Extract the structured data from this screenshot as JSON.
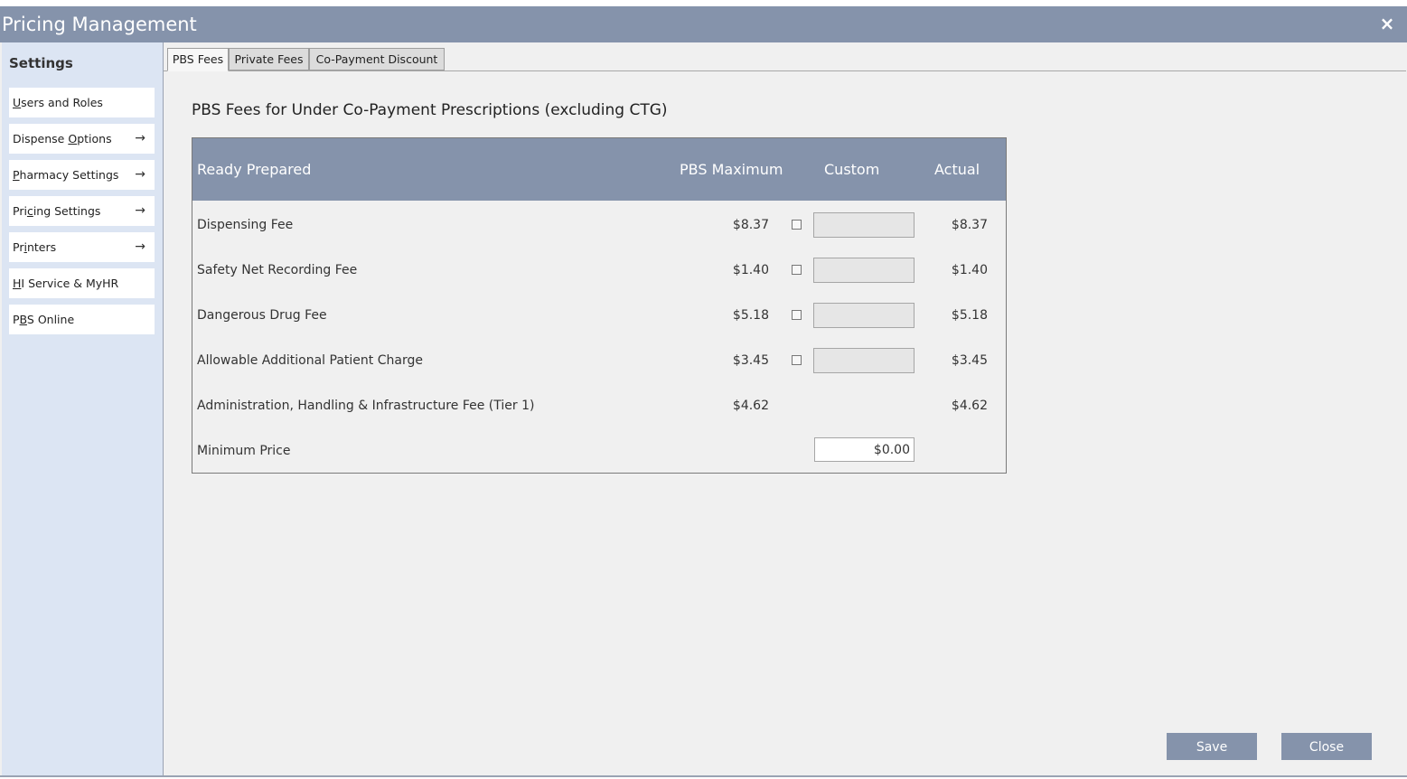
{
  "window": {
    "title": "Pricing Management",
    "close_glyph": "×"
  },
  "sidebar": {
    "heading": "Settings",
    "items": [
      {
        "pre": "",
        "u": "U",
        "post": "sers and Roles",
        "has_arrow": false
      },
      {
        "pre": "Dispense ",
        "u": "O",
        "post": "ptions",
        "has_arrow": true
      },
      {
        "pre": "",
        "u": "P",
        "post": "harmacy Settings",
        "has_arrow": true
      },
      {
        "pre": "Pri",
        "u": "c",
        "post": "ing Settings",
        "has_arrow": true
      },
      {
        "pre": "Pr",
        "u": "i",
        "post": "nters",
        "has_arrow": true
      },
      {
        "pre": "",
        "u": "H",
        "post": "I Service & MyHR",
        "has_arrow": false
      },
      {
        "pre": "P",
        "u": "B",
        "post": "S Online",
        "has_arrow": false
      }
    ],
    "arrow_glyph": "→"
  },
  "tabs": [
    {
      "label": "PBS Fees",
      "active": true
    },
    {
      "label": "Private Fees",
      "active": false
    },
    {
      "label": "Co-Payment Discount",
      "active": false
    }
  ],
  "section_title": "PBS Fees for Under Co-Payment Prescriptions (excluding CTG)",
  "table": {
    "headers": {
      "label": "Ready Prepared",
      "max": "PBS Maximum",
      "custom": "Custom",
      "actual": "Actual"
    },
    "rows": [
      {
        "label": "Dispensing Fee",
        "max": "$8.37",
        "actual": "$8.37",
        "custom_value": ""
      },
      {
        "label": "Safety Net Recording Fee",
        "max": "$1.40",
        "actual": "$1.40",
        "custom_value": ""
      },
      {
        "label": "Dangerous Drug Fee",
        "max": "$5.18",
        "actual": "$5.18",
        "custom_value": ""
      },
      {
        "label": "Allowable Additional Patient Charge",
        "max": "$3.45",
        "actual": "$3.45",
        "custom_value": ""
      },
      {
        "label": "Administration, Handling & Infrastructure Fee (Tier 1)",
        "max": "$4.62",
        "actual": "$4.62"
      },
      {
        "label": "Minimum Price",
        "custom_value": "$0.00"
      }
    ]
  },
  "buttons": {
    "save": "Save",
    "close": "Close"
  },
  "colors": {
    "accent": "#8593ab",
    "sidebar_bg": "#dce5f3",
    "content_bg": "#f0f0f0"
  },
  "icons": {
    "close": "close-icon",
    "arrow": "arrow-right-icon"
  }
}
